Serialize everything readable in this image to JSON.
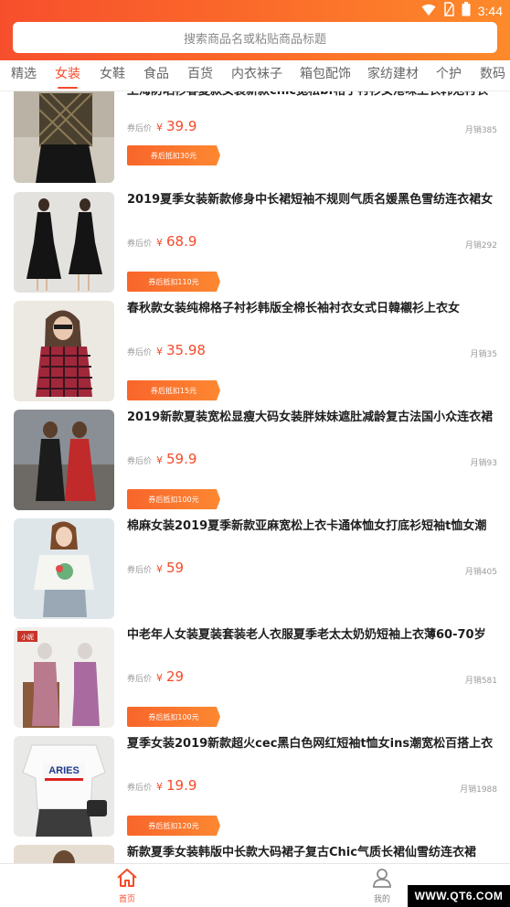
{
  "status_bar": {
    "time": "3:44"
  },
  "search": {
    "placeholder": "搜索商品名或粘贴商品标题"
  },
  "tabs": [
    {
      "label": "精选",
      "active": false
    },
    {
      "label": "女装",
      "active": true
    },
    {
      "label": "女鞋",
      "active": false
    },
    {
      "label": "食品",
      "active": false
    },
    {
      "label": "百货",
      "active": false
    },
    {
      "label": "内衣袜子",
      "active": false
    },
    {
      "label": "箱包配饰",
      "active": false
    },
    {
      "label": "家纺建材",
      "active": false
    },
    {
      "label": "个护",
      "active": false
    },
    {
      "label": "数码",
      "active": false
    }
  ],
  "products": [
    {
      "title": "上海防晒衫春夏款女装新款chic宽松bf格子衬衫女港味上衣韩范衬衣",
      "price_label": "券后价",
      "currency": "¥",
      "price": "39.9",
      "sales": "月销385",
      "coupon": "券后抵扣30元"
    },
    {
      "title": "2019夏季女装新款修身中长裙短袖不规则气质名媛黑色雪纺连衣裙女",
      "price_label": "券后价",
      "currency": "¥",
      "price": "68.9",
      "sales": "月销292",
      "coupon": "券后抵扣110元"
    },
    {
      "title": "春秋款女装纯棉格子衬衫韩版全棉长袖衬衣女式日韓襯衫上衣女",
      "price_label": "券后价",
      "currency": "¥",
      "price": "35.98",
      "sales": "月销35",
      "coupon": "券后抵扣15元"
    },
    {
      "title": "2019新款夏装宽松显瘦大码女装胖妹妹遮肚减龄复古法国小众连衣裙",
      "price_label": "券后价",
      "currency": "¥",
      "price": "59.9",
      "sales": "月销93",
      "coupon": "券后抵扣100元"
    },
    {
      "title": "棉麻女装2019夏季新款亚麻宽松上衣卡通体恤女打底衫短袖t恤女潮",
      "price_label": "券后价",
      "currency": "¥",
      "price": "59",
      "sales": "月销405",
      "coupon": ""
    },
    {
      "title": "中老年人女装夏装套装老人衣服夏季老太太奶奶短袖上衣薄60-70岁",
      "price_label": "券后价",
      "currency": "¥",
      "price": "29",
      "sales": "月销581",
      "coupon": "券后抵扣100元"
    },
    {
      "title": "夏季女装2019新款超火cec黑白色网红短袖t恤女ins潮宽松百搭上衣",
      "price_label": "券后价",
      "currency": "¥",
      "price": "19.9",
      "sales": "月销1988",
      "coupon": "券后抵扣120元"
    },
    {
      "title": "新款夏季女装韩版中长款大码裙子复古Chic气质长裙仙雪纺连衣裙",
      "price_label": "",
      "currency": "",
      "price": "",
      "sales": "",
      "coupon": ""
    }
  ],
  "thumb_tags": {
    "badge": "小妮",
    "shirt_text": "ARIES"
  },
  "bottom_nav": [
    {
      "label": "首页",
      "active": true,
      "icon": "home-icon"
    },
    {
      "label": "我的",
      "active": false,
      "icon": "user-icon"
    }
  ],
  "watermark": "WWW.QT6.COM",
  "colors": {
    "accent": "#f44b2a",
    "header_start": "#f74f2c",
    "header_end": "#fd8a2a"
  }
}
